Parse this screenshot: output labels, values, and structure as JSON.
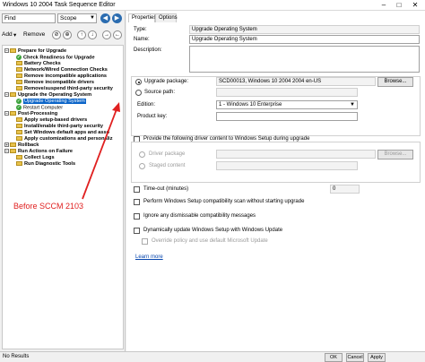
{
  "window": {
    "title": "Windows 10 2004 Task Sequence Editor",
    "controls": [
      "–",
      "□",
      "✕"
    ]
  },
  "left": {
    "find_label": "Find",
    "scope_value": "Scope",
    "nav": {
      "back": "◀",
      "forward": "▶"
    },
    "toolbar": {
      "add": "Add",
      "remove": "Remove"
    },
    "tree": [
      {
        "label": "Prepare for Upgrade",
        "type": "group"
      },
      {
        "label": "Check Readiness for Upgrade",
        "type": "step"
      },
      {
        "label": "Battery Checks",
        "type": "step"
      },
      {
        "label": "Network/Wired Connection Checks",
        "type": "step"
      },
      {
        "label": "Remove incompatible applications",
        "type": "step"
      },
      {
        "label": "Remove incompatible drivers",
        "type": "step"
      },
      {
        "label": "Remove/suspend third-party security",
        "type": "step"
      },
      {
        "label": "Upgrade the Operating System",
        "type": "group"
      },
      {
        "label": "Upgrade Operating System",
        "type": "step",
        "selected": true
      },
      {
        "label": "Restart Computer",
        "type": "step"
      },
      {
        "label": "Post-Processing",
        "type": "group"
      },
      {
        "label": "Apply setup-based drivers",
        "type": "step"
      },
      {
        "label": "Install/enable third-party security",
        "type": "step"
      },
      {
        "label": "Set Windows default apps and asso",
        "type": "step"
      },
      {
        "label": "Apply customizations and personaliz",
        "type": "step"
      },
      {
        "label": "Rollback",
        "type": "group"
      },
      {
        "label": "Run Actions on Failure",
        "type": "group"
      },
      {
        "label": "Collect Logs",
        "type": "step"
      },
      {
        "label": "Run Diagnostic Tools",
        "type": "step"
      }
    ]
  },
  "annotation": "Before SCCM 2103",
  "right": {
    "tabs": [
      "Properties",
      "Options"
    ],
    "type_label": "Type:",
    "type_value": "Upgrade Operating System",
    "name_label": "Name:",
    "name_value": "Upgrade Operating System",
    "description_label": "Description:",
    "upgrade_package_label": "Upgrade package:",
    "upgrade_package_value": "SCD00013, Windows 10 2004 2004 en-US",
    "browse": "Browse...",
    "source_path_label": "Source path:",
    "edition_label": "Edition:",
    "edition_value": "1 - Windows 10 Enterprise",
    "product_key_label": "Product key:",
    "provide_driver_label": "Provide the following driver content to Windows Setup during upgrade",
    "driver_package_label": "Driver package",
    "staged_content_label": "Staged content",
    "timeout_label": "Time-out (minutes)",
    "timeout_value": "0",
    "perform_scan_label": "Perform Windows Setup compatibility scan without starting upgrade",
    "ignore_label": "Ignore any dismissable compatibility messages",
    "dynamic_update_label": "Dynamically update Windows Setup with Windows Update",
    "override_label": "Override policy and use default Microsoft Update",
    "learn_more": "Learn more"
  },
  "bottom": {
    "status": "No Results",
    "ok": "OK",
    "cancel": "Cancel",
    "apply": "Apply"
  }
}
